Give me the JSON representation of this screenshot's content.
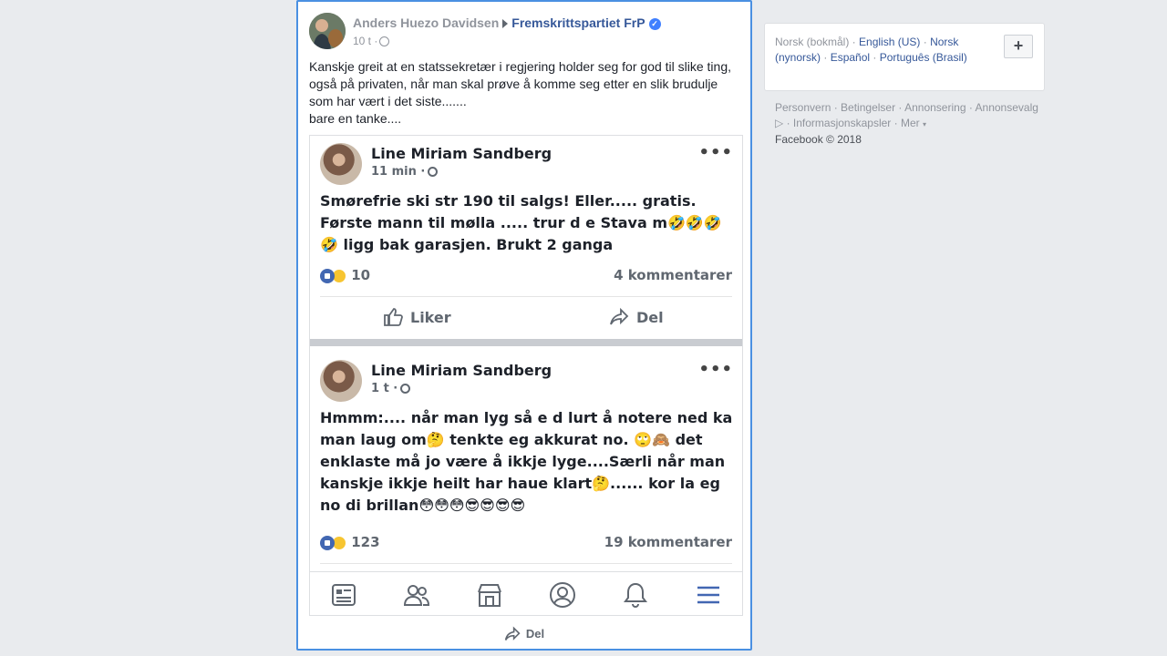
{
  "post": {
    "author": "Anders Huezo Davidsen",
    "page": "Fremskrittspartiet FrP",
    "time": "10 t ·",
    "text_lines": [
      "Kanskje greit at en statssekretær i regjering holder seg for god til slike ting, også på privaten, når man skal prøve å komme seg etter en slik brudulje som har vært i det siste.......",
      "bare en tanke...."
    ],
    "share_label": "Del"
  },
  "embedded": [
    {
      "name": "Line Miriam Sandberg",
      "time": "11 min ·",
      "body": "Smørefrie ski str 190 til salgs! Eller..... gratis. Første mann til mølla ..... trur d e Stava m🤣🤣🤣🤣 ligg bak garasjen.  Brukt 2 ganga",
      "reactions": "10",
      "comments": "4 kommentarer",
      "like_label": "Liker",
      "share_label": "Del"
    },
    {
      "name": "Line Miriam Sandberg",
      "time": "1 t ·",
      "body": "Hmmm:.... når man lyg så e d lurt å notere ned ka man laug om🤔 tenkte eg akkurat no. 🙄🙈 det enklaste må jo være å ikkje lyge....Særli når man kanskje ikkje heilt har haue klart🤔...... kor la eg no di brillan😳😳😳😎😎😎😎",
      "reactions": "123",
      "comments": "19 kommentarer"
    }
  ],
  "sidebar": {
    "lang_current": "Norsk (bokmål) ·",
    "langs": [
      "English (US)",
      "Norsk (nynorsk)",
      "Español",
      "Português (Brasil)"
    ],
    "plus": "+",
    "links": [
      "Personvern",
      "Betingelser",
      "Annonsering",
      "Annonsevalg",
      "Informasjonskapsler",
      "Mer"
    ],
    "copyright": "Facebook © 2018"
  },
  "colors": {
    "link": "#365899",
    "accent_border": "#4a90e2",
    "like_blue": "#4267b2"
  }
}
